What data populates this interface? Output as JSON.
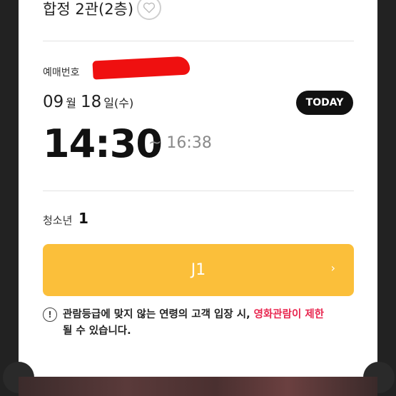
{
  "theater": {
    "name": "합정 2관(2층)"
  },
  "reservation": {
    "label": "예매번호"
  },
  "date": {
    "month": "09",
    "month_unit": "월",
    "day": "18",
    "day_unit": "일",
    "weekday": "(수)",
    "today_badge": "TODAY"
  },
  "time": {
    "start": "14:30",
    "end": "~ 16:38"
  },
  "tickets": {
    "type": "청소년",
    "count": "1"
  },
  "seat": {
    "label": "J1",
    "chevron": "›"
  },
  "notice": {
    "text_before": "관람등급에 맞지 않는 연령의 고객 입장 시, ",
    "highlight": "영화관람이 제한",
    "text_after": "될 수 있습니다.",
    "icon_glyph": "!"
  },
  "colors": {
    "seat_button": "#fbbf3a",
    "highlight": "#e8264f",
    "redaction": "#ef1010"
  }
}
